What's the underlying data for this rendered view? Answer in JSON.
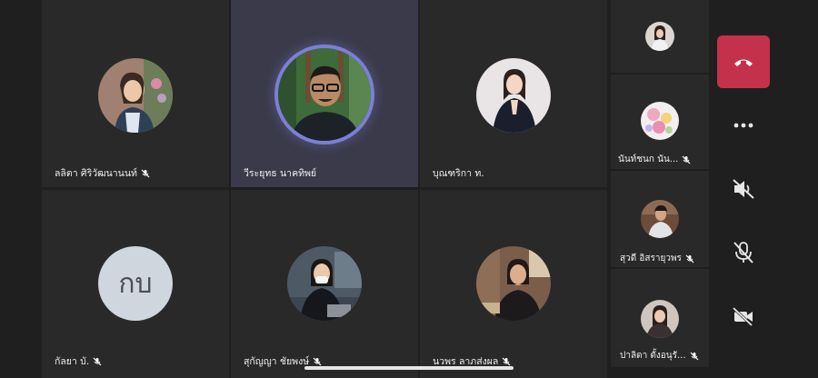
{
  "participants": [
    {
      "name": "ลลิตา ศิริวัฒนานนท์",
      "muted": true
    },
    {
      "name": "วีระยุทธ นาคทิพย์",
      "muted": false,
      "speaking": true
    },
    {
      "name": "บุณฑริกา ท.",
      "muted": false
    },
    {
      "name": "กัลยา บั.",
      "muted": true,
      "initials": "กบ"
    },
    {
      "name": "สุกัญญา ชัยพงษ์",
      "muted": true
    },
    {
      "name": "นวพร ลาภส่งผล",
      "muted": true
    }
  ],
  "side_participants": [
    {
      "name": "",
      "muted": false
    },
    {
      "name": "นันท์ชนก นัน...",
      "muted": true
    },
    {
      "name": "สุวดี อิสรายุวพร",
      "muted": true
    },
    {
      "name": "ปาลิดา ตั้งอนุรั...",
      "muted": true
    }
  ],
  "controls": {
    "hangup": "hang-up",
    "more": "more-options",
    "speaker": "speaker-off",
    "mic": "mic-off",
    "camera": "camera-off"
  },
  "colors": {
    "accent": "#7b7fd6",
    "hangup": "#c4314b"
  }
}
